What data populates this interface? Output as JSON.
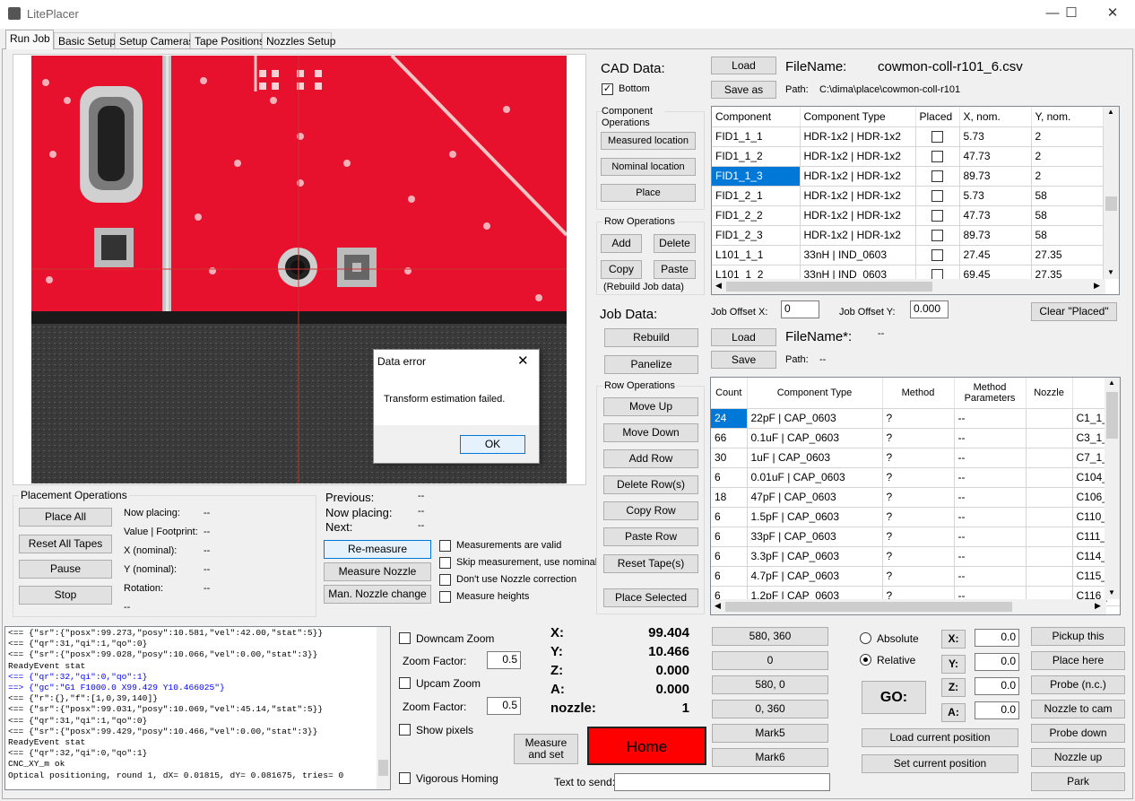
{
  "window": {
    "title": "LitePlacer",
    "minimize_glyph": "—",
    "maximize_glyph": "☐",
    "close_glyph": "✕"
  },
  "tabs": [
    "Run Job",
    "Basic Setup",
    "Setup Cameras",
    "Tape Positions",
    "Nozzles Setup"
  ],
  "dialog": {
    "title": "Data error",
    "message": "Transform estimation failed.",
    "ok_label": "OK"
  },
  "placement": {
    "group_title": "Placement Operations",
    "buttons": [
      "Place All",
      "Reset All Tapes",
      "Pause",
      "Stop"
    ],
    "labels": [
      "Now placing:",
      "Value | Footprint:",
      "X (nominal):",
      "Y (nominal):",
      "Rotation:"
    ],
    "values": [
      "--",
      "--",
      "--",
      "--",
      "--"
    ],
    "extra_value": "--",
    "prev_label": "Previous:",
    "prev_value": "--",
    "nowplacing_label": "Now placing:",
    "nowplacing_value": "--",
    "next_label": "Next:",
    "next_value": "--",
    "remeasure": "Re-measure",
    "measure_nozzle": "Measure Nozzle",
    "man_nozzle_change": "Man. Nozzle change",
    "checks": [
      "Measurements are valid",
      "Skip measurement, use nominal",
      "Don't use Nozzle correction",
      "Measure heights"
    ]
  },
  "cad": {
    "title": "CAD Data:",
    "bottom_label": "Bottom",
    "bottom_checked": true,
    "comp_ops_title": "Component Operations",
    "comp_ops": [
      "Measured location",
      "Nominal location",
      "Place"
    ],
    "row_ops_title": "Row Operations",
    "add": "Add",
    "delete": "Delete",
    "copy": "Copy",
    "paste": "Paste",
    "rebuild_note": "(Rebuild Job data)",
    "load": "Load",
    "save_as": "Save as",
    "filename_label": "FileName:",
    "filename": "cowmon-coll-r101_6.csv",
    "path_label": "Path:",
    "path": "C:\\dima\\place\\cowmon-coll-r101",
    "columns": [
      "Component",
      "Component Type",
      "Placed",
      "X, nom.",
      "Y, nom."
    ],
    "rows": [
      [
        "FID1_1_1",
        "HDR-1x2  |  HDR-1x2",
        "",
        "5.73",
        "2"
      ],
      [
        "FID1_1_2",
        "HDR-1x2  |  HDR-1x2",
        "",
        "47.73",
        "2"
      ],
      [
        "FID1_1_3",
        "HDR-1x2  |  HDR-1x2",
        "",
        "89.73",
        "2"
      ],
      [
        "FID1_2_1",
        "HDR-1x2  |  HDR-1x2",
        "",
        "5.73",
        "58"
      ],
      [
        "FID1_2_2",
        "HDR-1x2  |  HDR-1x2",
        "",
        "47.73",
        "58"
      ],
      [
        "FID1_2_3",
        "HDR-1x2  |  HDR-1x2",
        "",
        "89.73",
        "58"
      ],
      [
        "L101_1_1",
        "33nH  |  IND_0603",
        "",
        "27.45",
        "27.35"
      ],
      [
        "L101_1_2",
        "33nH  |  IND_0603",
        "",
        "69.45",
        "27.35"
      ]
    ],
    "selected_row": 2
  },
  "job": {
    "title": "Job Data:",
    "rebuild": "Rebuild",
    "panelize": "Panelize",
    "offset_x_label": "Job Offset X:",
    "offset_x": "0",
    "offset_y_label": "Job Offset Y:",
    "offset_y": "0.000",
    "clear_placed": "Clear \"Placed\"",
    "load": "Load",
    "save": "Save",
    "filename_label": "FileName*:",
    "filename": "--",
    "path_label": "Path:",
    "path": "--",
    "row_ops_title": "Row Operations",
    "row_ops": [
      "Move Up",
      "Move Down",
      "Add Row",
      "Delete Row(s)",
      "Copy Row",
      "Paste Row",
      "Reset Tape(s)",
      "Place Selected"
    ],
    "columns": [
      "Count",
      "Component Type",
      "Method",
      "Method Parameters",
      "Nozzle",
      "C"
    ],
    "rows": [
      [
        "24",
        "22pF  |  CAP_0603",
        "?",
        "--",
        "",
        "C1_1_"
      ],
      [
        "66",
        "0.1uF  |  CAP_0603",
        "?",
        "--",
        "",
        "C3_1_"
      ],
      [
        "30",
        "1uF  |  CAP_0603",
        "?",
        "--",
        "",
        "C7_1_"
      ],
      [
        "6",
        "0.01uF  |  CAP_0603",
        "?",
        "--",
        "",
        "C104_"
      ],
      [
        "18",
        "47pF  |  CAP_0603",
        "?",
        "--",
        "",
        "C106_"
      ],
      [
        "6",
        "1.5pF  |  CAP_0603",
        "?",
        "--",
        "",
        "C110_"
      ],
      [
        "6",
        "33pF  |  CAP_0603",
        "?",
        "--",
        "",
        "C111_"
      ],
      [
        "6",
        "3.3pF  |  CAP_0603",
        "?",
        "--",
        "",
        "C114_"
      ],
      [
        "6",
        "4.7pF  |  CAP_0603",
        "?",
        "--",
        "",
        "C115_"
      ],
      [
        "6",
        "1.2pF  |  CAP_0603",
        "?",
        "--",
        "",
        "C116_"
      ]
    ]
  },
  "log": [
    {
      "t": "<== {\"sr\":{\"posx\":99.273,\"posy\":10.581,\"vel\":42.00,\"stat\":5}}",
      "c": "#000"
    },
    {
      "t": "<== {\"qr\":31,\"qi\":1,\"qo\":0}",
      "c": "#000"
    },
    {
      "t": "<== {\"sr\":{\"posx\":99.028,\"posy\":10.066,\"vel\":0.00,\"stat\":3}}",
      "c": "#000"
    },
    {
      "t": "ReadyEvent stat",
      "c": "#000"
    },
    {
      "t": "<== {\"qr\":32,\"qi\":0,\"qo\":1}",
      "c": "#0000ff"
    },
    {
      "t": "==> {\"gc\":\"G1 F1000.0 X99.429 Y10.466025\"}",
      "c": "#0000ff"
    },
    {
      "t": "<== {\"r\":{},\"f\":[1,0,39,140]}",
      "c": "#000"
    },
    {
      "t": "<== {\"sr\":{\"posx\":99.031,\"posy\":10.069,\"vel\":45.14,\"stat\":5}}",
      "c": "#000"
    },
    {
      "t": "<== {\"qr\":31,\"qi\":1,\"qo\":0}",
      "c": "#000"
    },
    {
      "t": "<== {\"sr\":{\"posx\":99.429,\"posy\":10.466,\"vel\":0.00,\"stat\":3}}",
      "c": "#000"
    },
    {
      "t": "ReadyEvent stat",
      "c": "#000"
    },
    {
      "t": "<== {\"qr\":32,\"qi\":0,\"qo\":1}",
      "c": "#000"
    },
    {
      "t": "CNC_XY_m ok",
      "c": "#000"
    },
    {
      "t": "Optical positioning, round 1, dX= 0.01815, dY= 0.081675, tries= 0",
      "c": "#000"
    }
  ],
  "zoom": {
    "downcam": "Downcam Zoom",
    "factor_label": "Zoom Factor:",
    "downcam_factor": "0.5",
    "upcam": "Upcam Zoom",
    "upcam_factor": "0.5",
    "show_pixels": "Show pixels",
    "vigorous": "Vigorous Homing"
  },
  "position": {
    "labels": [
      "X:",
      "Y:",
      "Z:",
      "A:",
      "nozzle:"
    ],
    "values": [
      "99.404",
      "10.466",
      "0.000",
      "0.000",
      "1"
    ],
    "measure_and_set": "Measure and set",
    "home": "Home",
    "text_to_send_label": "Text to send:",
    "text_to_send": ""
  },
  "marks": [
    "580, 360",
    "0",
    "580, 0",
    "0, 360",
    "Mark5",
    "Mark6"
  ],
  "jog": {
    "absolute": "Absolute",
    "relative": "Relative",
    "mode": "relative",
    "go": "GO:",
    "axes": [
      "X:",
      "Y:",
      "Z:",
      "A:"
    ],
    "values": [
      "0.0",
      "0.0",
      "0.0",
      "0.0"
    ],
    "load_current": "Load current position",
    "set_current": "Set current position"
  },
  "right_buttons": [
    "Pickup this",
    "Place here",
    "Probe (n.c.)",
    "Nozzle to cam",
    "Probe down",
    "Nozzle up",
    "Park"
  ],
  "colors": {
    "home_button": "#ff0000",
    "selected_row": "#0078d7",
    "pcb": "#e8112d"
  }
}
